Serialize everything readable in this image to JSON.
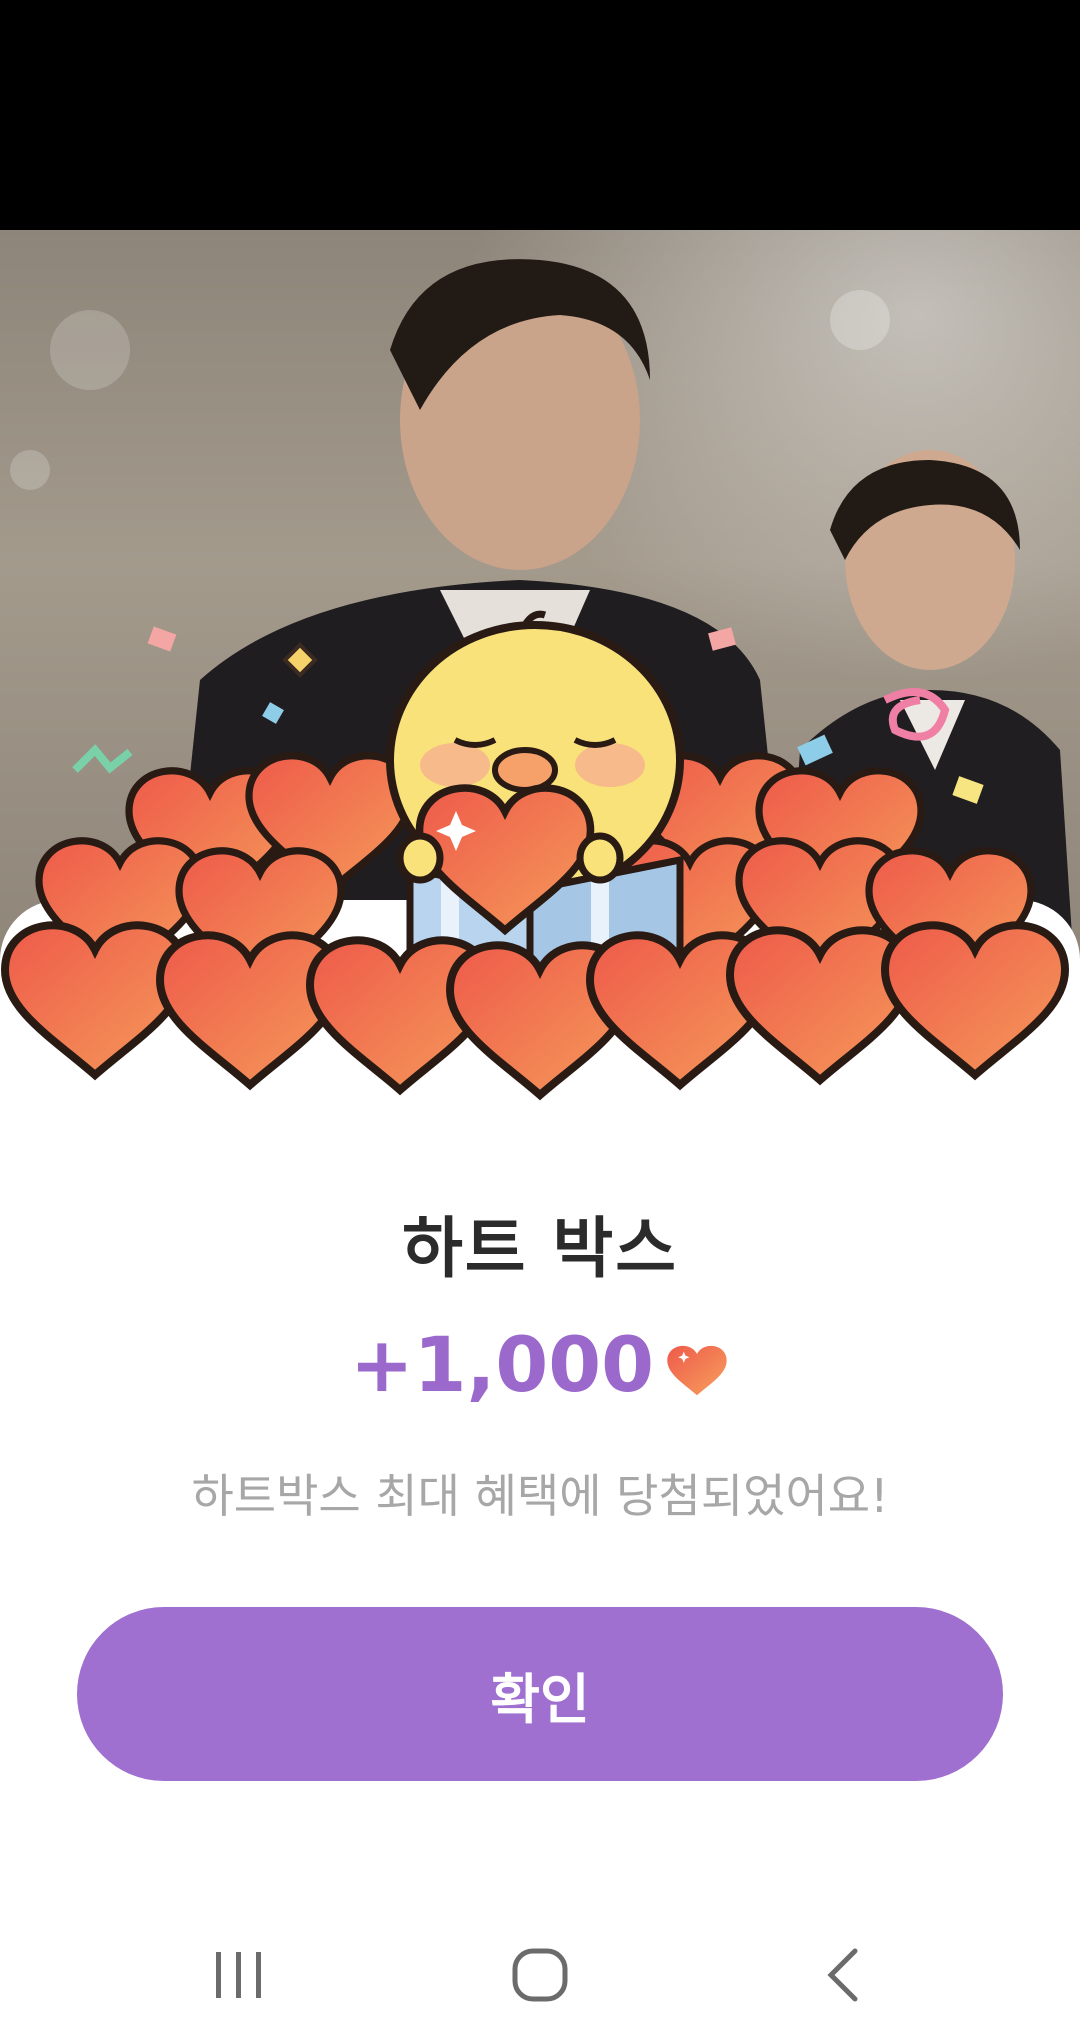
{
  "dialog": {
    "title": "하트 박스",
    "reward_amount": "+1,000",
    "description": "하트박스 최대 혜택에 당첨되었어요!",
    "confirm_label": "확인"
  },
  "icons": {
    "reward_icon": "heart-icon",
    "nav_recents": "recent-apps-icon",
    "nav_home": "home-icon",
    "nav_back": "back-icon"
  },
  "colors": {
    "accent": "#a070d0",
    "amount_text": "#9b68cc",
    "heart": "#ef6a4f",
    "chick": "#f9e27a"
  }
}
